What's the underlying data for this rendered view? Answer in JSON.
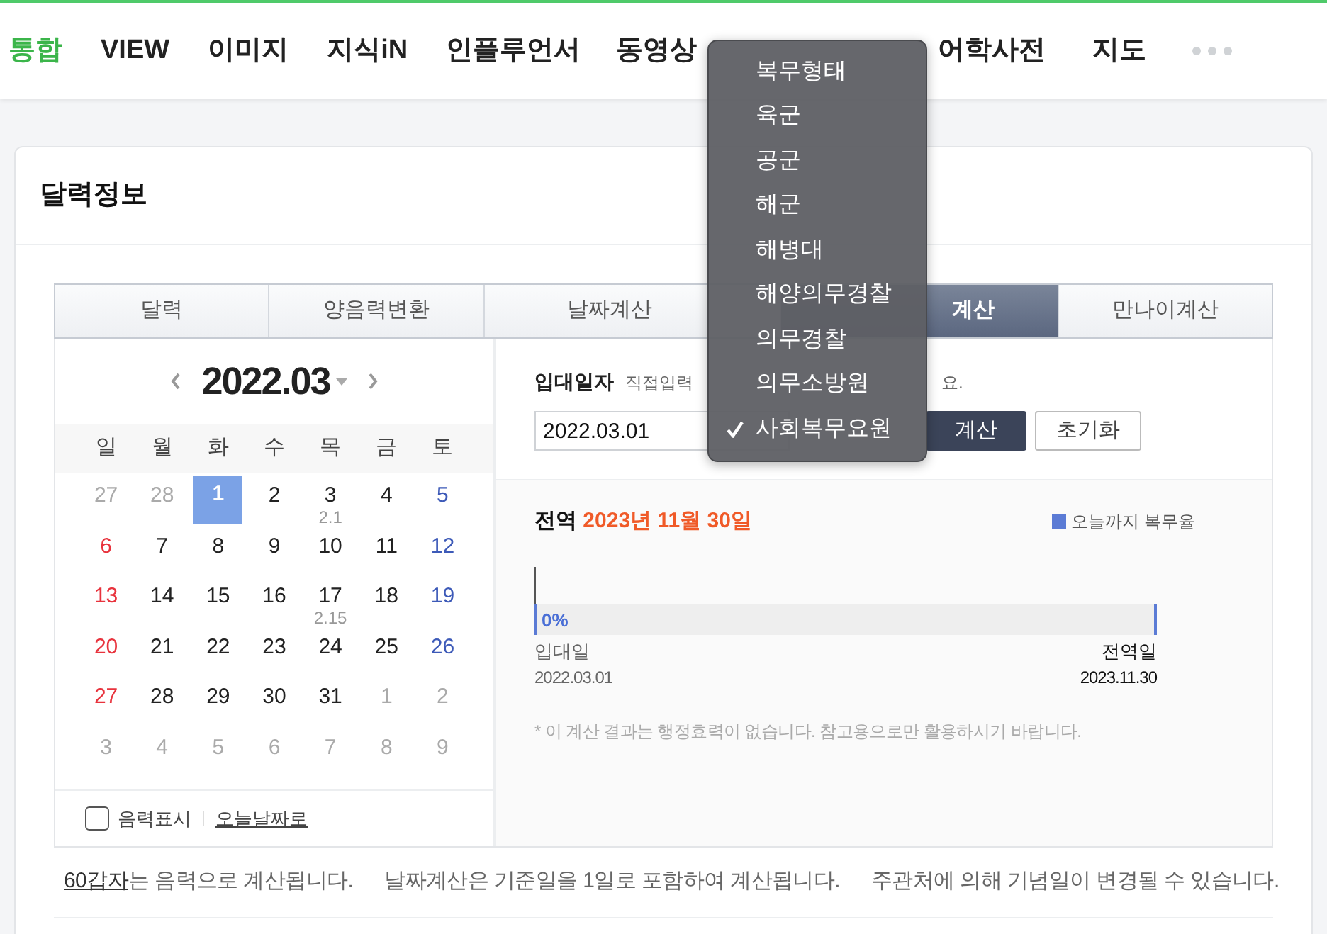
{
  "nav": {
    "items": [
      {
        "label": "통합",
        "selected": true
      },
      {
        "label": "VIEW",
        "selected": false
      },
      {
        "label": "이미지",
        "selected": false
      },
      {
        "label": "지식iN",
        "selected": false
      },
      {
        "label": "인플루언서",
        "selected": false
      },
      {
        "label": "동영상",
        "selected": false
      },
      {
        "label": "어학사전",
        "selected": false
      },
      {
        "label": "지도",
        "selected": false
      }
    ]
  },
  "card": {
    "title": "달력정보"
  },
  "tabs": [
    {
      "label": "달력",
      "selected": false
    },
    {
      "label": "양음력변환",
      "selected": false
    },
    {
      "label": "날짜계산",
      "selected": false
    },
    {
      "label": "계산",
      "selected": true
    },
    {
      "label": "만나이계산",
      "selected": false
    }
  ],
  "calendar": {
    "month": "2022.03",
    "weekdays": [
      "일",
      "월",
      "화",
      "수",
      "목",
      "금",
      "토"
    ],
    "weeks": [
      [
        {
          "day": "27",
          "muted": true,
          "selected": false
        },
        {
          "day": "28",
          "muted": true,
          "selected": false
        },
        {
          "day": "1",
          "muted": false,
          "selected": true
        },
        {
          "day": "2",
          "muted": false,
          "selected": false
        },
        {
          "day": "3",
          "muted": false,
          "selected": false,
          "lunar": "2.1"
        },
        {
          "day": "4",
          "muted": false,
          "selected": false
        },
        {
          "day": "5",
          "muted": false,
          "selected": false
        }
      ],
      [
        {
          "day": "6",
          "muted": false,
          "selected": false
        },
        {
          "day": "7",
          "muted": false,
          "selected": false
        },
        {
          "day": "8",
          "muted": false,
          "selected": false
        },
        {
          "day": "9",
          "muted": false,
          "selected": false
        },
        {
          "day": "10",
          "muted": false,
          "selected": false
        },
        {
          "day": "11",
          "muted": false,
          "selected": false
        },
        {
          "day": "12",
          "muted": false,
          "selected": false
        }
      ],
      [
        {
          "day": "13",
          "muted": false,
          "selected": false
        },
        {
          "day": "14",
          "muted": false,
          "selected": false
        },
        {
          "day": "15",
          "muted": false,
          "selected": false
        },
        {
          "day": "16",
          "muted": false,
          "selected": false
        },
        {
          "day": "17",
          "muted": false,
          "selected": false,
          "lunar": "2.15"
        },
        {
          "day": "18",
          "muted": false,
          "selected": false
        },
        {
          "day": "19",
          "muted": false,
          "selected": false
        }
      ],
      [
        {
          "day": "20",
          "muted": false,
          "selected": false
        },
        {
          "day": "21",
          "muted": false,
          "selected": false
        },
        {
          "day": "22",
          "muted": false,
          "selected": false
        },
        {
          "day": "23",
          "muted": false,
          "selected": false
        },
        {
          "day": "24",
          "muted": false,
          "selected": false
        },
        {
          "day": "25",
          "muted": false,
          "selected": false
        },
        {
          "day": "26",
          "muted": false,
          "selected": false
        }
      ],
      [
        {
          "day": "27",
          "muted": false,
          "selected": false
        },
        {
          "day": "28",
          "muted": false,
          "selected": false
        },
        {
          "day": "29",
          "muted": false,
          "selected": false
        },
        {
          "day": "30",
          "muted": false,
          "selected": false
        },
        {
          "day": "31",
          "muted": false,
          "selected": false
        },
        {
          "day": "1",
          "muted": true,
          "selected": false
        },
        {
          "day": "2",
          "muted": true,
          "selected": false
        }
      ],
      [
        {
          "day": "3",
          "muted": true,
          "selected": false
        },
        {
          "day": "4",
          "muted": true,
          "selected": false
        },
        {
          "day": "5",
          "muted": true,
          "selected": false
        },
        {
          "day": "6",
          "muted": true,
          "selected": false
        },
        {
          "day": "7",
          "muted": true,
          "selected": false
        },
        {
          "day": "8",
          "muted": true,
          "selected": false
        },
        {
          "day": "9",
          "muted": true,
          "selected": false
        }
      ]
    ],
    "lunar_toggle": {
      "label": "음력표시",
      "checked": false
    },
    "today_link": "오늘날짜로"
  },
  "form": {
    "label": "입대일자",
    "hint_start": "직접입력",
    "hint_end": "요.",
    "date_value": "2022.03.01",
    "calculate": "계산",
    "reset": "초기화"
  },
  "result": {
    "prefix": "전역",
    "date": "2023년 11월 30일",
    "legend": "오늘까지 복무율",
    "level": 0,
    "percent": "0%",
    "start_label": "입대일",
    "start_date": "2022.03.01",
    "end_label": "전역일",
    "end_date": "2023.11.30",
    "note": "* 이 계산 결과는 행정효력이 없습니다. 참고용으로만 활용하시기 바랍니다."
  },
  "footnotes": [
    {
      "link": "60갑자",
      "text": "는 음력으로 계산됩니다."
    },
    {
      "text": "날짜계산은 기준일을 1일로 포함하여 계산됩니다."
    },
    {
      "text": "주관처에 의해 기념일이 변경될 수 있습니다."
    }
  ],
  "menu": {
    "items": [
      {
        "label": "복무형태",
        "checked": false
      },
      {
        "label": "육군",
        "checked": false
      },
      {
        "label": "공군",
        "checked": false
      },
      {
        "label": "해군",
        "checked": false
      },
      {
        "label": "해병대",
        "checked": false
      },
      {
        "label": "해양의무경찰",
        "checked": false
      },
      {
        "label": "의무경찰",
        "checked": false
      },
      {
        "label": "의무소방원",
        "checked": false
      },
      {
        "label": "사회복무요원",
        "checked": true
      }
    ]
  }
}
